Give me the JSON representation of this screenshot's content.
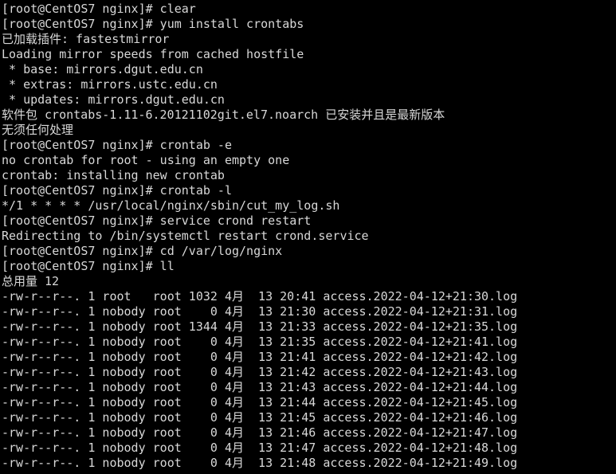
{
  "terminal": {
    "title": "CentOS7 terminal session",
    "background_color": "#000000",
    "foreground_color": "#d8d8d8",
    "prompt": "[root@CentOS7 nginx]#",
    "lines": [
      "[root@CentOS7 nginx]# clear",
      "[root@CentOS7 nginx]# yum install crontabs",
      "已加载插件: fastestmirror",
      "Loading mirror speeds from cached hostfile",
      " * base: mirrors.dgut.edu.cn",
      " * extras: mirrors.ustc.edu.cn",
      " * updates: mirrors.dgut.edu.cn",
      "软件包 crontabs-1.11-6.20121102git.el7.noarch 已安装并且是最新版本",
      "无须任何处理",
      "[root@CentOS7 nginx]# crontab -e",
      "no crontab for root - using an empty one",
      "crontab: installing new crontab",
      "[root@CentOS7 nginx]# crontab -l",
      "*/1 * * * * /usr/local/nginx/sbin/cut_my_log.sh",
      "[root@CentOS7 nginx]# service crond restart",
      "Redirecting to /bin/systemctl restart crond.service",
      "[root@CentOS7 nginx]# cd /var/log/nginx",
      "[root@CentOS7 nginx]# ll",
      "总用量 12",
      "-rw-r--r--. 1 root   root 1032 4月  13 20:41 access.2022-04-12+21:30.log",
      "-rw-r--r--. 1 nobody root    0 4月  13 21:30 access.2022-04-12+21:31.log",
      "-rw-r--r--. 1 nobody root 1344 4月  13 21:33 access.2022-04-12+21:35.log",
      "-rw-r--r--. 1 nobody root    0 4月  13 21:35 access.2022-04-12+21:41.log",
      "-rw-r--r--. 1 nobody root    0 4月  13 21:41 access.2022-04-12+21:42.log",
      "-rw-r--r--. 1 nobody root    0 4月  13 21:42 access.2022-04-12+21:43.log",
      "-rw-r--r--. 1 nobody root    0 4月  13 21:43 access.2022-04-12+21:44.log",
      "-rw-r--r--. 1 nobody root    0 4月  13 21:44 access.2022-04-12+21:45.log",
      "-rw-r--r--. 1 nobody root    0 4月  13 21:45 access.2022-04-12+21:46.log",
      "-rw-r--r--. 1 nobody root    0 4月  13 21:46 access.2022-04-12+21:47.log",
      "-rw-r--r--. 1 nobody root    0 4月  13 21:47 access.2022-04-12+21:48.log",
      "-rw-r--r--. 1 nobody root    0 4月  13 21:48 access.2022-04-12+21:49.log"
    ]
  }
}
